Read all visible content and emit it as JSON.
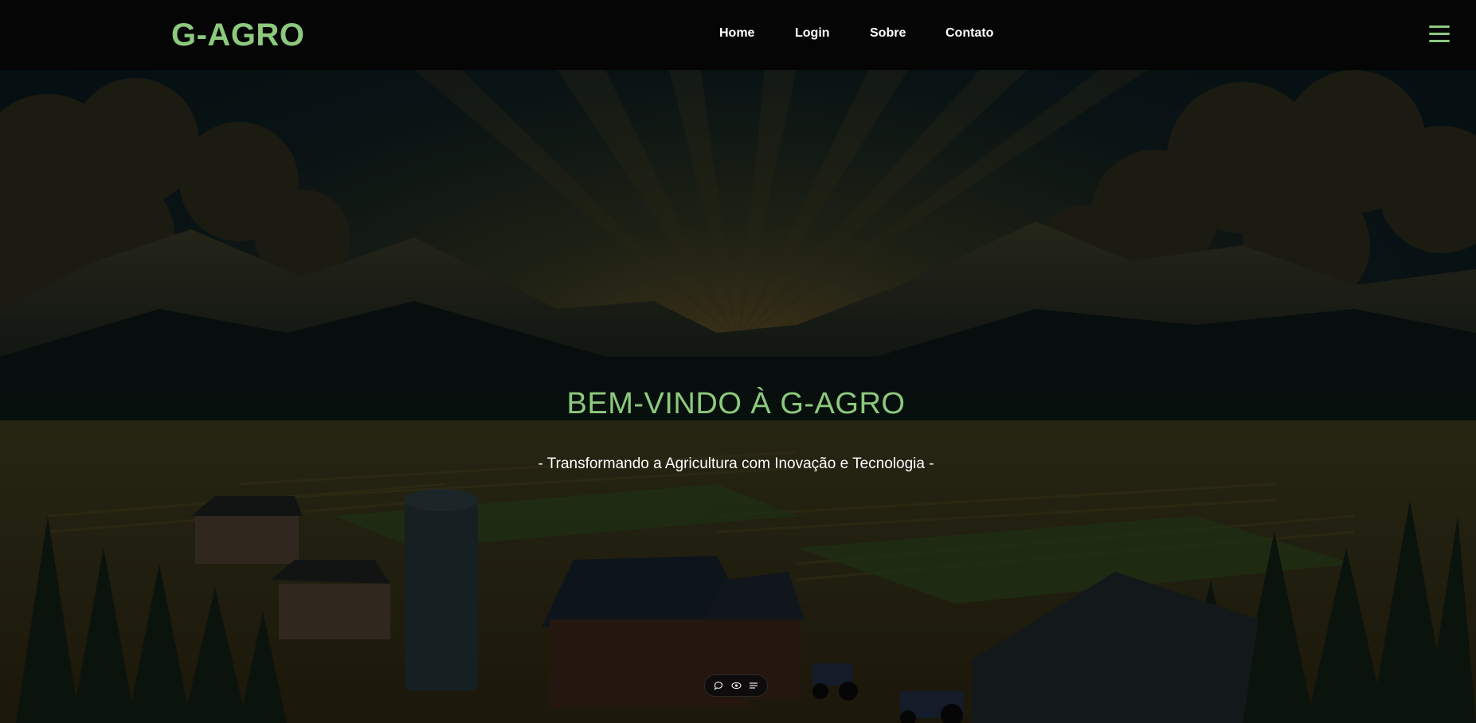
{
  "brand": {
    "name": "G-AGRO",
    "color": "#8cc97e"
  },
  "nav": {
    "items": [
      {
        "label": "Home"
      },
      {
        "label": "Login"
      },
      {
        "label": "Sobre"
      },
      {
        "label": "Contato"
      }
    ],
    "menu_icon": "hamburger-menu-icon"
  },
  "hero": {
    "title": "BEM-VINDO À G-AGRO",
    "subtitle": "- Transformando a Agricultura com Inovação e Tecnologia -",
    "background": "farm-landscape-illustration"
  },
  "toolbar": {
    "icons": [
      "chat-bubble-icon",
      "eye-icon",
      "list-icon"
    ]
  },
  "colors": {
    "accent": "#8cc97e",
    "navbar_bg": "#050505",
    "text_light": "#ffffff"
  }
}
